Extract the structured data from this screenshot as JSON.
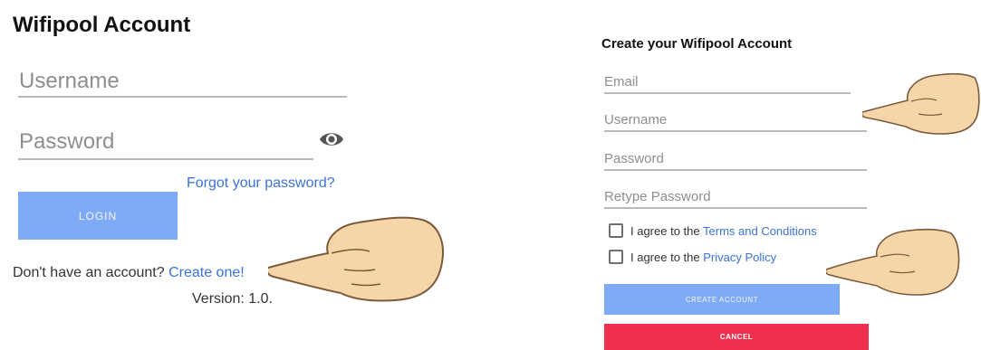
{
  "login": {
    "title": "Wifipool Account",
    "username_placeholder": "Username",
    "password_placeholder": "Password",
    "forgot_password": "Forgot your password?",
    "login_label": "LOGIN",
    "no_account_text": "Don't have an account?",
    "create_link": "Create one!",
    "version": "Version: 1.0."
  },
  "register": {
    "title": "Create your Wifipool Account",
    "fields": [
      "Email",
      "Username",
      "Password",
      "Retype Password"
    ],
    "terms_prefix": "I agree to the",
    "terms_link": "Terms and Conditions",
    "privacy_prefix": "I agree to the",
    "privacy_link": "Privacy Policy",
    "create_label": "CREATE ACCOUNT",
    "cancel_label": "CANCEL"
  },
  "colors": {
    "accent_button": "#7faaf6",
    "link": "#3b73d6",
    "cancel": "#ee2f4d"
  },
  "icons": [
    "eye-icon",
    "pointing-hand-icon"
  ]
}
